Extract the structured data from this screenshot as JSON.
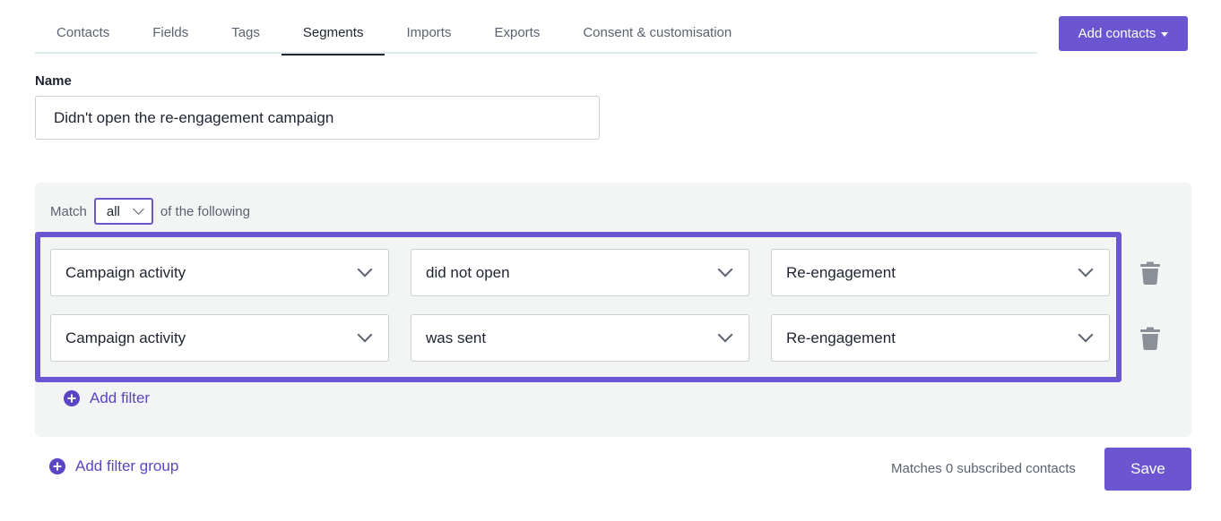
{
  "tabs": [
    {
      "label": "Contacts",
      "active": false
    },
    {
      "label": "Fields",
      "active": false
    },
    {
      "label": "Tags",
      "active": false
    },
    {
      "label": "Segments",
      "active": true
    },
    {
      "label": "Imports",
      "active": false
    },
    {
      "label": "Exports",
      "active": false
    },
    {
      "label": "Consent & customisation",
      "active": false
    }
  ],
  "header": {
    "add_contacts_label": "Add contacts"
  },
  "name_field": {
    "label": "Name",
    "value": "Didn't open the re-engagement campaign"
  },
  "filter_group": {
    "match_prefix": "Match",
    "match_value": "all",
    "match_suffix": "of the following",
    "filters": [
      {
        "field": "Campaign activity",
        "condition": "did not open",
        "value": "Re-engagement"
      },
      {
        "field": "Campaign activity",
        "condition": "was sent",
        "value": "Re-engagement"
      }
    ],
    "add_filter_label": "Add filter"
  },
  "footer": {
    "add_filter_group_label": "Add filter group",
    "matches_text": "Matches 0 subscribed contacts",
    "save_label": "Save"
  },
  "colors": {
    "accent": "#6c55d0",
    "link": "#5a45c5",
    "panel_bg": "#f3f4f4",
    "trash_icon": "#8a8f98"
  }
}
